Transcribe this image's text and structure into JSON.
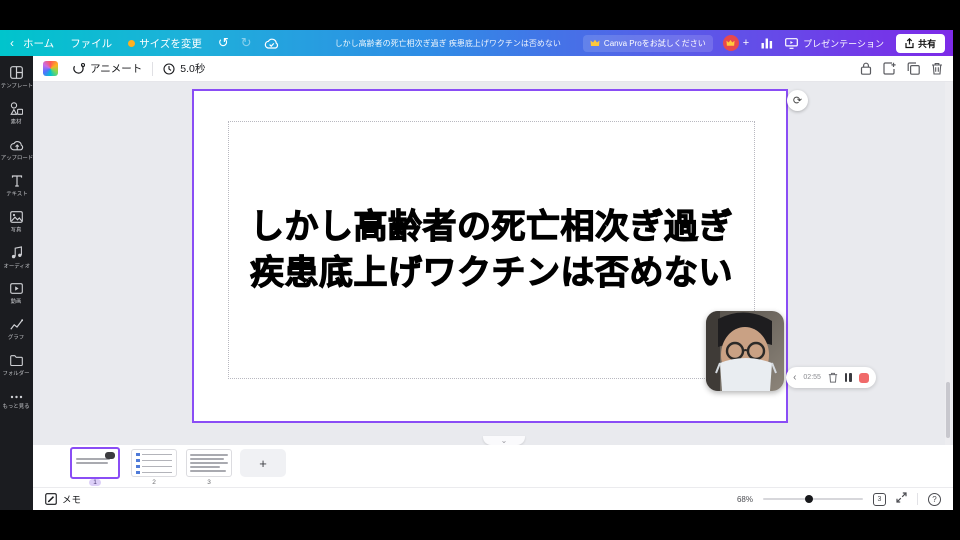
{
  "colors": {
    "topbar_gradient_start": "#00c4cc",
    "topbar_gradient_end": "#7d2ae8",
    "selection_purple": "#8a4df5",
    "record_red": "#f06a6a",
    "avatar_red": "#e8484d",
    "crown_gold": "#ffc93c",
    "resize_dot_orange": "#ffb01f",
    "sidebar_bg": "#1b1c20",
    "canvas_bg": "#e9eaee"
  },
  "icons": {
    "chevron_left": "‹",
    "undo": "↺",
    "redo": "↻",
    "plus": "+",
    "ellipsis": "•••",
    "chevron_down": "⌄",
    "refresh": "⟳",
    "question": "?",
    "text_tool": "T"
  },
  "topbar": {
    "home": "ホーム",
    "file": "ファイル",
    "resize": "サイズを変更",
    "doc_title": "しかし高齢者の死亡相次ぎ過ぎ 疾患底上げワクチンは否めない",
    "pro_button": "Canva Proをお試しください",
    "presentation": "プレゼンテーション",
    "share": "共有"
  },
  "sidebar": {
    "items": [
      {
        "label": "テンプレート",
        "icon": "template-icon"
      },
      {
        "label": "素材",
        "icon": "elements-icon"
      },
      {
        "label": "アップロード",
        "icon": "upload-icon"
      },
      {
        "label": "テキスト",
        "icon": "text-icon"
      },
      {
        "label": "写真",
        "icon": "photos-icon"
      },
      {
        "label": "オーディオ",
        "icon": "audio-icon"
      },
      {
        "label": "動画",
        "icon": "video-icon"
      },
      {
        "label": "グラフ",
        "icon": "chart-icon"
      },
      {
        "label": "フォルダー",
        "icon": "folder-icon"
      },
      {
        "label": "もっと見る",
        "icon": "more-icon"
      }
    ]
  },
  "toolbar": {
    "animate_label": "アニメート",
    "duration_label": "5.0秒"
  },
  "slide": {
    "line1": "しかし高齢者の死亡相次ぎ過ぎ",
    "line2": "疾患底上げワクチンは否めない"
  },
  "recording": {
    "time": "02:55"
  },
  "filmstrip": {
    "pages": [
      "1",
      "2",
      "3"
    ],
    "add_label": "+"
  },
  "statusbar": {
    "notes_label": "メモ",
    "zoom_percent": "68%",
    "page_count": "3"
  }
}
